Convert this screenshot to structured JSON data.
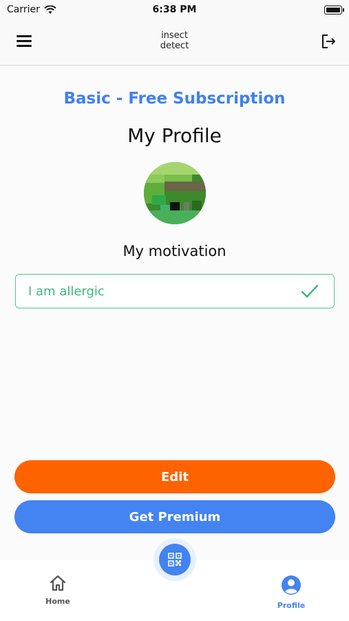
{
  "status_bar": {
    "carrier": "Carrier",
    "time": "6:38 PM"
  },
  "header": {
    "logo_line1": "insect",
    "logo_line2": "detect"
  },
  "main": {
    "subscription": "Basic - Free Subscription",
    "title": "My Profile",
    "motivation_label": "My motivation",
    "motivation_value": "I am allergic"
  },
  "buttons": {
    "edit": "Edit",
    "premium": "Get Premium"
  },
  "tabs": [
    {
      "label": "Home",
      "icon": "home-icon"
    },
    {
      "label": "Profile",
      "icon": "profile-icon",
      "active": true
    }
  ],
  "colors": {
    "accent_blue": "#4383f2",
    "edit_orange": "#fe6300",
    "motivation_green": "#4fc98a"
  }
}
